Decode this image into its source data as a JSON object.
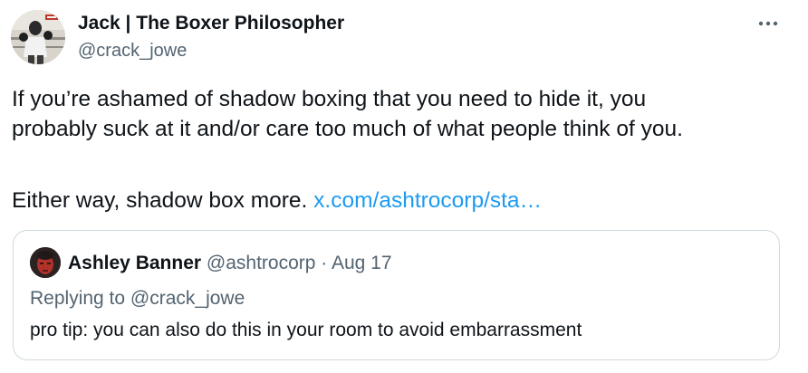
{
  "author": {
    "name": "Jack | The Boxer Philosopher",
    "handle": "@crack_jowe",
    "avatar_icon": "boxer-avatar"
  },
  "more_icon": "more-horizontal-icon",
  "tweet": {
    "line1": "If you’re ashamed of shadow boxing that you need to hide it, you",
    "line2": "probably suck at it and/or care too much of what people think of you.",
    "line3_text": "Either way, shadow box more. ",
    "line3_link": "x.com/ashtrocorp/sta…"
  },
  "quote": {
    "name": "Ashley Banner",
    "handle": "@ashtrocorp",
    "separator": " · ",
    "date": "Aug 17",
    "replying_prefix": "Replying to ",
    "replying_to": "@crack_jowe",
    "text": "pro tip: you can also do this in your room to avoid embarrassment",
    "avatar_icon": "red-face-avatar"
  },
  "colors": {
    "link": "#1d9bf0",
    "secondary_text": "#536471",
    "border": "#cfd9de",
    "primary_text": "#0f1419"
  }
}
